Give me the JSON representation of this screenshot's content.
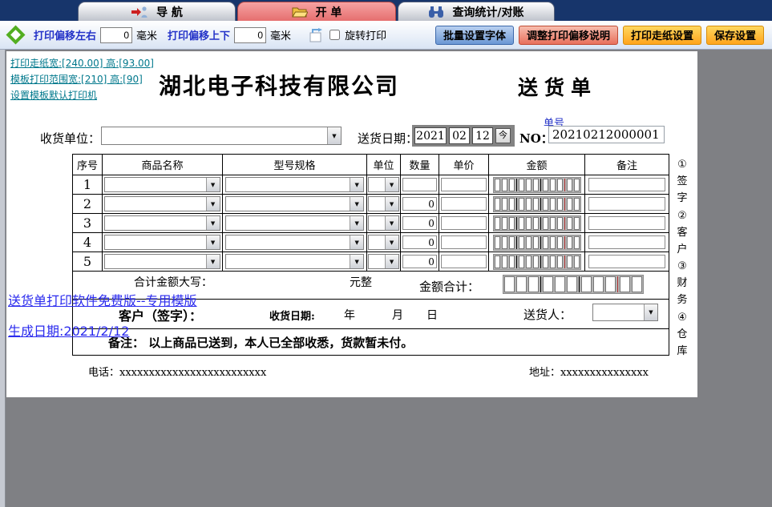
{
  "colors": {
    "tab_bar_bg": "#17356b",
    "active_tab": "#ee8484",
    "toolbar_label_blue": "#2433c8",
    "teal_link": "#00788c",
    "blue_link": "#2a2aee",
    "button_blue": "#6b97d4",
    "button_red": "#e8705c",
    "button_orange": "#ffa41c",
    "amount_grid_red_divider": "#b03030"
  },
  "tabs": [
    {
      "label": "导 航"
    },
    {
      "label": "开 单"
    },
    {
      "label": "查询统计/对账"
    }
  ],
  "toolbar": {
    "offset_lr_label": "打印偏移左右",
    "offset_lr_value": "0",
    "offset_lr_unit": "毫米",
    "offset_ud_label": "打印偏移上下",
    "offset_ud_value": "0",
    "offset_ud_unit": "毫米",
    "rotate_label": "旋转打印",
    "buttons": [
      {
        "label": "批量设置字体"
      },
      {
        "label": "调整打印偏移说明"
      },
      {
        "label": "打印走纸设置"
      },
      {
        "label": "保存设置"
      }
    ]
  },
  "template_links": [
    {
      "label": "打印走纸宽:[240.00] 高:[93.00]"
    },
    {
      "label": "模板打印范围宽:[210] 高:[90]"
    },
    {
      "label": "设置模板默认打印机"
    }
  ],
  "doc": {
    "company": "湖北电子科技有限公司",
    "title": "送货单",
    "receiver_label": "收货单位：",
    "date_label": "送货日期：",
    "date": {
      "year": "2021",
      "month": "02",
      "day": "12",
      "today_button": "今"
    },
    "no_caption": "单号",
    "no_label": "NO：",
    "no_value": "20210212000001"
  },
  "table": {
    "headers": [
      "序号",
      "商品名称",
      "型号规格",
      "单位",
      "数量",
      "单价",
      "金额",
      "备注"
    ],
    "rows": [
      {
        "no": "1",
        "qty": ""
      },
      {
        "no": "2",
        "qty": "0"
      },
      {
        "no": "3",
        "qty": "0"
      },
      {
        "no": "4",
        "qty": "0"
      },
      {
        "no": "5",
        "qty": "0"
      }
    ],
    "total_words_label": "合计金额大写：",
    "total_words_value": "元整",
    "total_amount_label": "金额合计："
  },
  "signature": {
    "customer_label": "客户（签字）：",
    "receive_date_label": "收货日期:",
    "year": "年",
    "month": "月",
    "day": "日",
    "deliverer_label": "送货人："
  },
  "remark": {
    "label": "备注：",
    "text": "以上商品已送到，本人已全部收悉，货款暂未付。"
  },
  "contact": {
    "phone": "电话：xxxxxxxxxxxxxxxxxxxxxxxxx",
    "address": "地址：xxxxxxxxxxxxxxx"
  },
  "watermarks": [
    {
      "label": "送货单打印软件免费版--专用模版"
    },
    {
      "label": "生成日期:2021/2/12"
    }
  ],
  "side_labels": [
    {
      "num": "①",
      "c1": "签",
      "c2": "字"
    },
    {
      "num": "②",
      "c1": "客",
      "c2": "户"
    },
    {
      "num": "③",
      "c1": "财",
      "c2": "务"
    },
    {
      "num": "④",
      "c1": "仓",
      "c2": "库"
    }
  ]
}
